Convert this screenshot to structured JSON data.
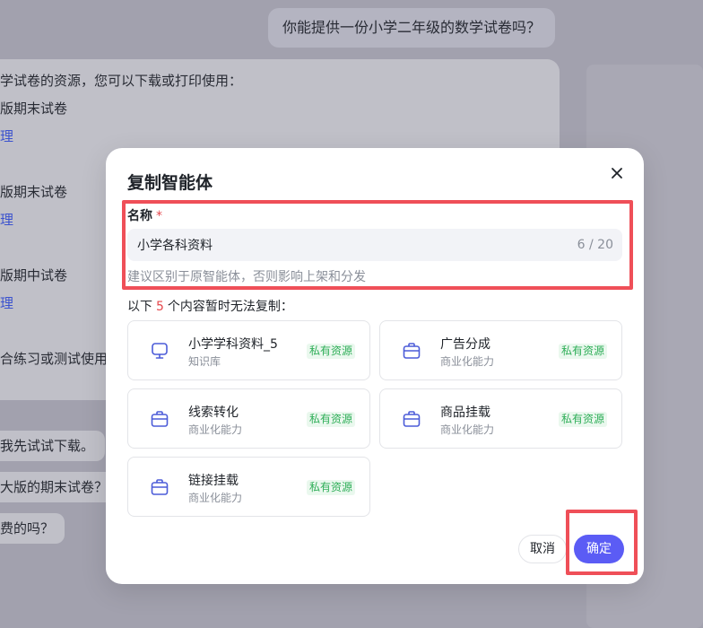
{
  "chat": {
    "user_message": "你能提供一份小学二年级的数学试卷吗？",
    "bot_lines": [
      "学试卷的资源，您可以下载或打印使用：",
      "版期末试卷",
      "理",
      "版期末试卷",
      "理",
      "版期中试卷",
      "理",
      "合练习或测试使用"
    ],
    "followups": [
      "我先试试下载。",
      "大版的期末试卷？",
      "费的吗？"
    ]
  },
  "modal": {
    "title": "复制智能体",
    "name_label": "名称",
    "required_mark": "*",
    "name_value": "小学各科资料",
    "name_count": "6 / 20",
    "hint": "建议区别于原智能体，否则影响上架和分发",
    "notice_prefix": "以下",
    "notice_count": "5",
    "notice_suffix": "个内容暂时无法复制：",
    "items": [
      {
        "title": "小学学科资料_5",
        "subtitle": "知识库",
        "badge": "私有资源",
        "icon": "monitor-icon"
      },
      {
        "title": "广告分成",
        "subtitle": "商业化能力",
        "badge": "私有资源",
        "icon": "briefcase-icon"
      },
      {
        "title": "线索转化",
        "subtitle": "商业化能力",
        "badge": "私有资源",
        "icon": "briefcase-icon"
      },
      {
        "title": "商品挂载",
        "subtitle": "商业化能力",
        "badge": "私有资源",
        "icon": "briefcase-icon"
      },
      {
        "title": "链接挂载",
        "subtitle": "商业化能力",
        "badge": "私有资源",
        "icon": "briefcase-icon"
      }
    ],
    "cancel_label": "取消",
    "confirm_label": "确定"
  },
  "colors": {
    "accent": "#5b5cf5",
    "highlight": "#ef4f58",
    "badge_bg": "#eaf8ee",
    "badge_text": "#2fae58",
    "icon": "#4b5bd8"
  }
}
